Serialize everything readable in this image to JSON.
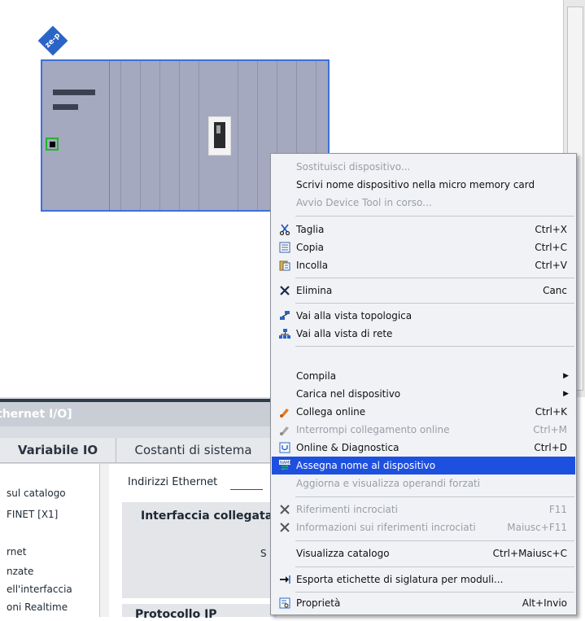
{
  "canvas": {
    "device_tag": "ze-p"
  },
  "panel": {
    "title": "thernet I/O]",
    "tabs": [
      {
        "label": "Variabile IO"
      },
      {
        "label": "Costanti di sistema"
      }
    ],
    "tree_items": [
      {
        "label": "sul catalogo"
      },
      {
        "label": "FINET [X1]"
      },
      {
        "label": "rnet"
      },
      {
        "label": "nzate"
      },
      {
        "label": "ell'interfaccia"
      },
      {
        "label": "oni Realtime"
      }
    ],
    "section_title": "Indirizzi Ethernet",
    "group1_title": "Interfaccia collegata",
    "sub_label": "S",
    "group2_title": "Protocollo IP"
  },
  "menu": {
    "items": [
      {
        "label": "Sostituisci dispositivo...",
        "shortcut": "",
        "icon": "",
        "disabled": true
      },
      {
        "label": "Scrivi nome dispositivo nella micro memory card",
        "shortcut": "",
        "icon": "",
        "disabled": false
      },
      {
        "label": "Avvio Device Tool in corso...",
        "shortcut": "",
        "icon": "",
        "disabled": true
      },
      {
        "label": "Taglia",
        "shortcut": "Ctrl+X",
        "icon": "scissors-icon",
        "disabled": false
      },
      {
        "label": "Copia",
        "shortcut": "Ctrl+C",
        "icon": "copy-icon",
        "disabled": false
      },
      {
        "label": "Incolla",
        "shortcut": "Ctrl+V",
        "icon": "paste-icon",
        "disabled": false
      },
      {
        "label": "Elimina",
        "shortcut": "Canc",
        "icon": "delete-icon",
        "disabled": false
      },
      {
        "label": "Vai alla vista topologica",
        "shortcut": "",
        "icon": "topology-icon",
        "disabled": false
      },
      {
        "label": "Vai alla vista di rete",
        "shortcut": "",
        "icon": "network-icon",
        "disabled": false
      },
      {
        "label": "Compila",
        "shortcut": "",
        "icon": "",
        "disabled": false,
        "submenu": true
      },
      {
        "label": "Carica nel dispositivo",
        "shortcut": "",
        "icon": "",
        "disabled": false,
        "submenu": true
      },
      {
        "label": "Collega online",
        "shortcut": "Ctrl+K",
        "icon": "connect-online-icon",
        "disabled": false
      },
      {
        "label": "Interrompi collegamento online",
        "shortcut": "Ctrl+M",
        "icon": "disconnect-online-icon",
        "disabled": true
      },
      {
        "label": "Online & Diagnostica",
        "shortcut": "Ctrl+D",
        "icon": "diagnostics-icon",
        "disabled": false
      },
      {
        "label": "Assegna nome al dispositivo",
        "shortcut": "",
        "icon": "assign-name-icon",
        "disabled": false,
        "selected": true
      },
      {
        "label": "Aggiorna e visualizza operandi forzati",
        "shortcut": "",
        "icon": "",
        "disabled": true
      },
      {
        "label": "Riferimenti incrociati",
        "shortcut": "F11",
        "icon": "cross-reference-icon",
        "disabled": true
      },
      {
        "label": "Informazioni sui riferimenti incrociati",
        "shortcut": "Maiusc+F11",
        "icon": "cross-reference-info-icon",
        "disabled": true
      },
      {
        "label": "Visualizza catalogo",
        "shortcut": "Ctrl+Maiusc+C",
        "icon": "",
        "disabled": false
      },
      {
        "label": "Esporta etichette di siglatura per moduli...",
        "shortcut": "",
        "icon": "export-arrow-icon",
        "disabled": false
      },
      {
        "label": "Proprietà",
        "shortcut": "Alt+Invio",
        "icon": "properties-icon",
        "disabled": false
      }
    ]
  },
  "colors": {
    "selection": "#1e50e0",
    "rack_fill": "#a4a9bf",
    "rack_border": "#3e70d6",
    "port_border": "#24b32b"
  }
}
